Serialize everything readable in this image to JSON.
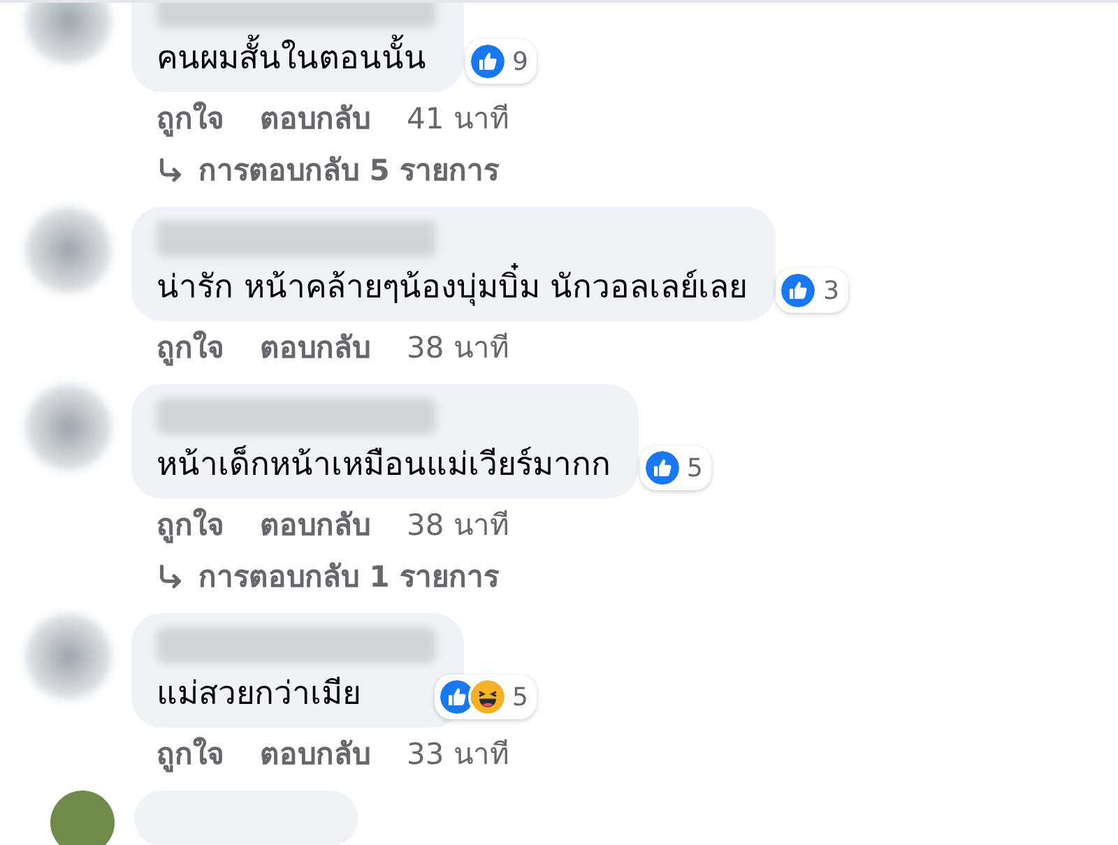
{
  "comments": [
    {
      "text": "คนผมสั้นในตอนนั้น",
      "reactions": [
        {
          "kind": "like"
        }
      ],
      "reaction_count": "9",
      "actions": [
        "ถูกใจ",
        "ตอบกลับ"
      ],
      "time": "41 นาที",
      "replies": "การตอบกลับ 5 รายการ"
    },
    {
      "text": "น่ารัก หน้าคล้ายๆน้องบุ่มบิ๋ม นักวอลเลย์เลย",
      "reactions": [
        {
          "kind": "like"
        }
      ],
      "reaction_count": "3",
      "actions": [
        "ถูกใจ",
        "ตอบกลับ"
      ],
      "time": "38 นาที"
    },
    {
      "text": "หน้าเด็กหน้าเหมือนแม่เวียร์มากก",
      "reactions": [
        {
          "kind": "like"
        }
      ],
      "reaction_count": "5",
      "actions": [
        "ถูกใจ",
        "ตอบกลับ"
      ],
      "time": "38 นาที",
      "replies": "การตอบกลับ 1 รายการ"
    },
    {
      "text": "แม่สวยกว่าเมีย",
      "reactions": [
        {
          "kind": "like"
        },
        {
          "kind": "haha"
        }
      ],
      "reaction_count": "5",
      "actions": [
        "ถูกใจ",
        "ตอบกลับ"
      ],
      "time": "33 นาที"
    }
  ]
}
